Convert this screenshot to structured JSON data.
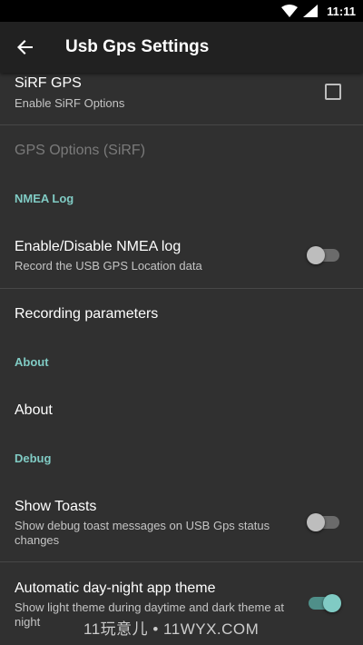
{
  "status_bar": {
    "time": "11:11",
    "icons": [
      "wifi-icon",
      "signal-icon"
    ]
  },
  "toolbar": {
    "title": "Usb Gps Settings",
    "back_icon": "arrow-back-icon"
  },
  "sirf_gps": {
    "title": "SiRF GPS",
    "summary": "Enable SiRF Options",
    "checked": false
  },
  "gps_options": {
    "title": "GPS Options (SiRF)",
    "enabled": false
  },
  "nmea_category": {
    "label": "NMEA Log"
  },
  "nmea_log": {
    "title": "Enable/Disable NMEA log",
    "summary": "Record the USB GPS Location data",
    "on": false
  },
  "recording": {
    "title": "Recording parameters"
  },
  "about_category": {
    "label": "About"
  },
  "about": {
    "title": "About"
  },
  "debug_category": {
    "label": "Debug"
  },
  "show_toasts": {
    "title": "Show Toasts",
    "summary": "Show debug toast messages on USB Gps status changes",
    "on": false
  },
  "day_night": {
    "title": "Automatic day-night app theme",
    "summary": "Show light theme during daytime and dark theme at night",
    "on": true
  },
  "watermark": {
    "text": "11玩意儿 • 11WYX.COM"
  },
  "colors": {
    "accent": "#80cbc4",
    "background": "#303030",
    "toolbar": "#212121",
    "status_bar": "#000000"
  }
}
